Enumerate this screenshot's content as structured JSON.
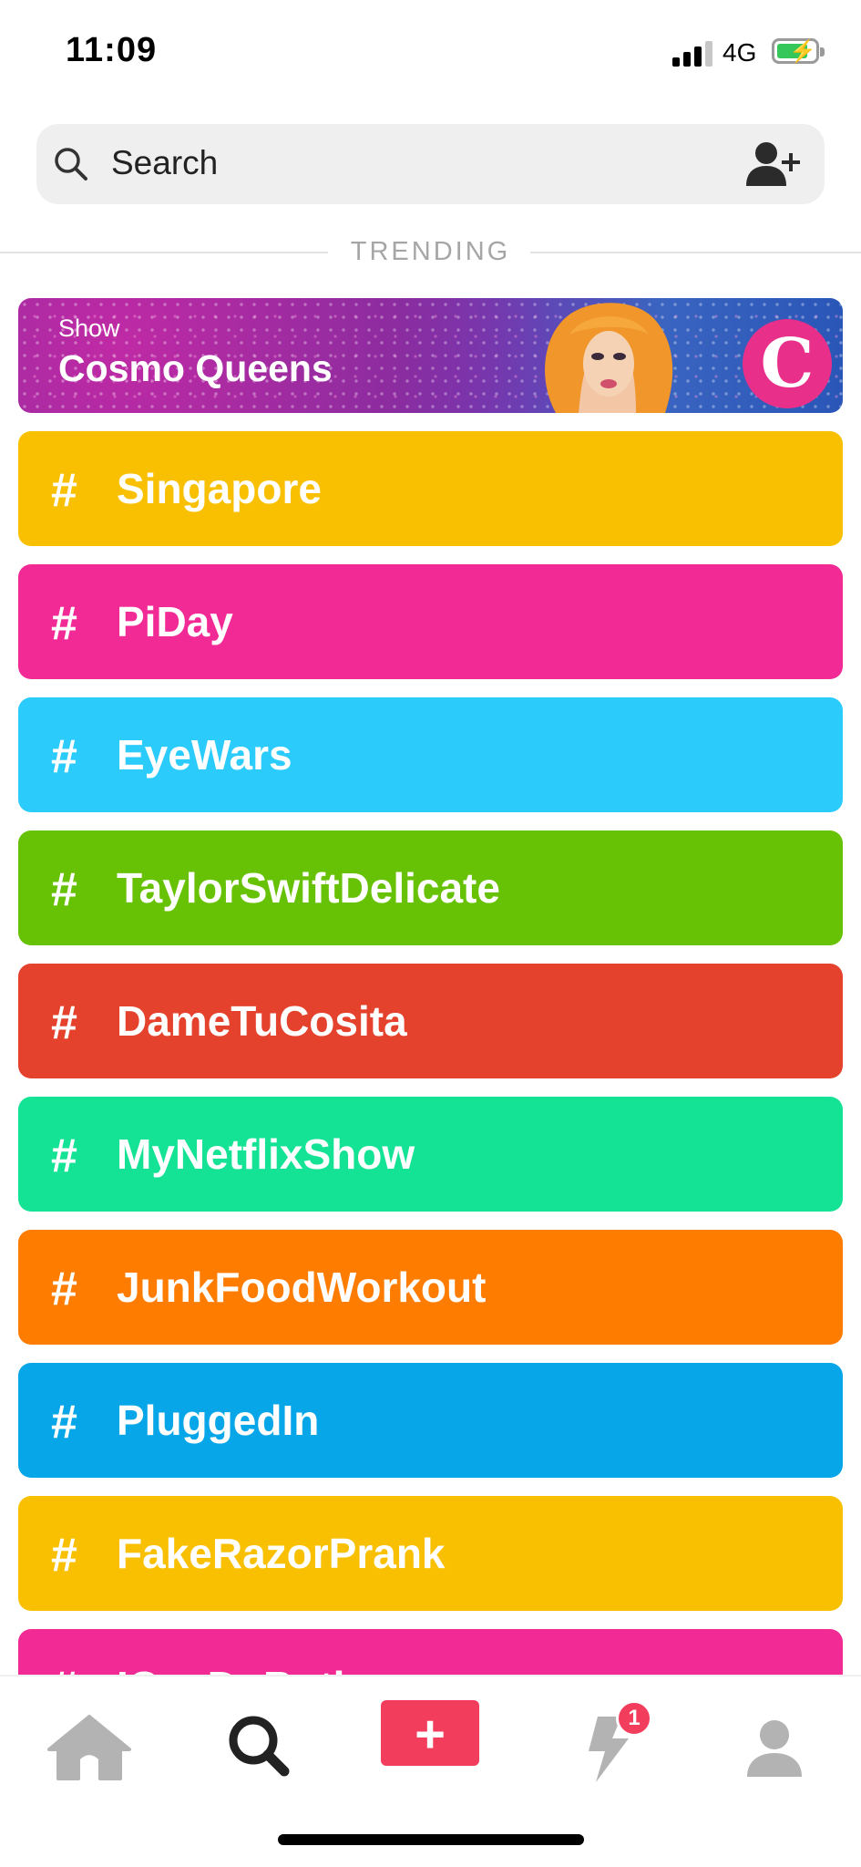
{
  "status_bar": {
    "time": "11:09",
    "network": "4G"
  },
  "search": {
    "placeholder": "Search"
  },
  "section_label": "TRENDING",
  "featured": {
    "kicker": "Show",
    "title": "Cosmo Queens",
    "logo_letter": "C"
  },
  "trending": [
    {
      "hash": "#",
      "name": "Singapore",
      "color": "#F8C000"
    },
    {
      "hash": "#",
      "name": "PiDay",
      "color": "#F22A95"
    },
    {
      "hash": "#",
      "name": "EyeWars",
      "color": "#2BCBFC"
    },
    {
      "hash": "#",
      "name": "TaylorSwiftDelicate",
      "color": "#67C104"
    },
    {
      "hash": "#",
      "name": "DameTuCosita",
      "color": "#E4422C"
    },
    {
      "hash": "#",
      "name": "MyNetflixShow",
      "color": "#14E295"
    },
    {
      "hash": "#",
      "name": "JunkFoodWorkout",
      "color": "#FE7C00"
    },
    {
      "hash": "#",
      "name": "PluggedIn",
      "color": "#07A6E8"
    },
    {
      "hash": "#",
      "name": "FakeRazorPrank",
      "color": "#F8C000"
    },
    {
      "hash": "#",
      "name": "ICanDoBoth",
      "color": "#F22A95"
    }
  ],
  "tab_bar": {
    "items": [
      {
        "icon": "home-icon"
      },
      {
        "icon": "search-icon"
      },
      {
        "icon": "plus-icon",
        "label": "+"
      },
      {
        "icon": "lightning-icon",
        "badge": "1"
      },
      {
        "icon": "profile-icon"
      }
    ]
  },
  "colors": {
    "accent": "#F23D5C"
  }
}
